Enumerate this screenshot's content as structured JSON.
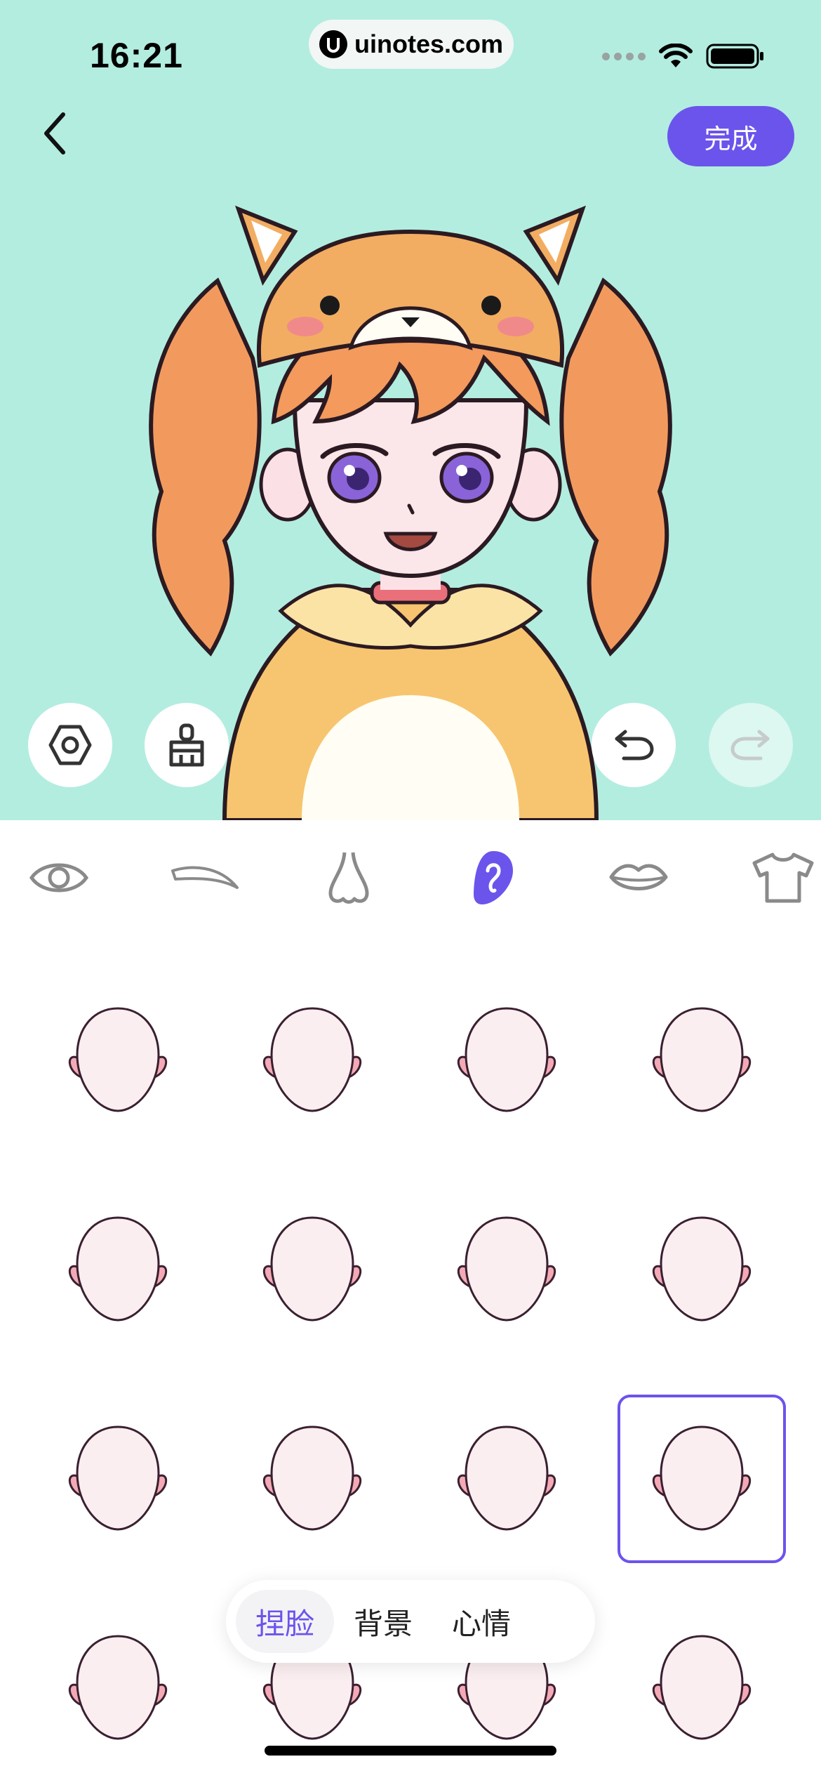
{
  "status_bar": {
    "time": "16:21",
    "url": "uinotes.com"
  },
  "header": {
    "back_icon": "chevron-left-icon",
    "done_label": "完成"
  },
  "toolbar": {
    "left": [
      {
        "name": "settings-hex-icon"
      },
      {
        "name": "brush-icon"
      }
    ],
    "right": [
      {
        "name": "undo-icon",
        "enabled": true
      },
      {
        "name": "redo-icon",
        "enabled": false
      }
    ]
  },
  "categories": [
    {
      "name": "eye-icon",
      "active": false
    },
    {
      "name": "eyebrow-icon",
      "active": false
    },
    {
      "name": "nose-icon",
      "active": false
    },
    {
      "name": "ear-icon",
      "active": true
    },
    {
      "name": "lips-icon",
      "active": false
    },
    {
      "name": "shirt-icon",
      "active": false
    }
  ],
  "face_options": {
    "count": 16,
    "selected_index": 11
  },
  "segment": {
    "tabs": [
      "捏脸",
      "背景",
      "心情"
    ],
    "active_index": 0
  },
  "colors": {
    "accent": "#6b54ec",
    "stage_bg": "#b3ede0",
    "face_fill": "#fbeef0",
    "ear_fill": "#f3aab6"
  }
}
